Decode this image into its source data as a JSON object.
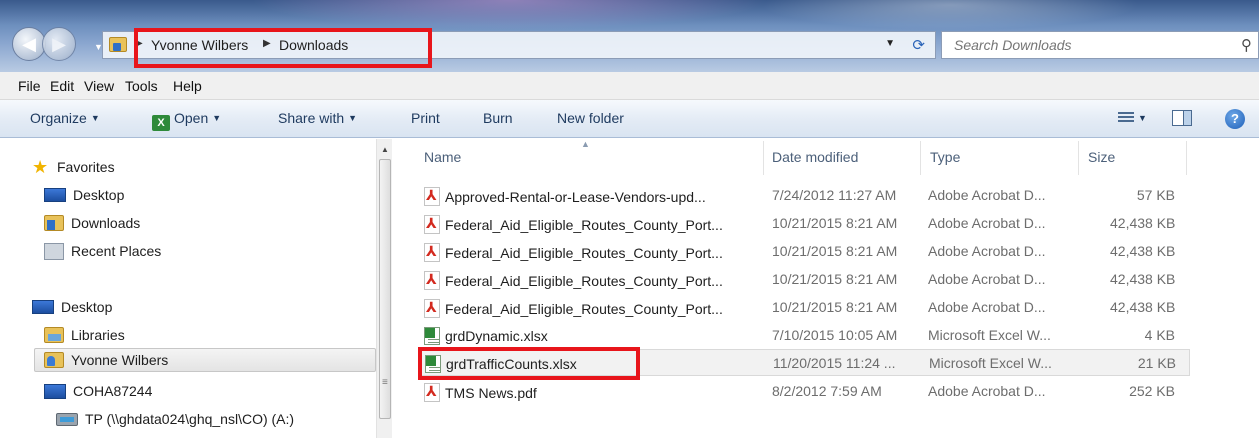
{
  "address": {
    "breadcrumbs": [
      "Yvonne Wilbers",
      "Downloads"
    ],
    "search_placeholder": "Search Downloads"
  },
  "menu": [
    "File",
    "Edit",
    "View",
    "Tools",
    "Help"
  ],
  "toolbar": {
    "organize": "Organize",
    "open": "Open",
    "share_with": "Share with",
    "print": "Print",
    "burn": "Burn",
    "new_folder": "New folder"
  },
  "nav": {
    "favorites": "Favorites",
    "desktop_fav": "Desktop",
    "downloads": "Downloads",
    "recent_places": "Recent Places",
    "desktop_root": "Desktop",
    "libraries": "Libraries",
    "user": "Yvonne Wilbers",
    "computer": "COHA87244",
    "network_drive": "TP (\\\\ghdata024\\ghq_nsl\\CO) (A:)"
  },
  "columns": {
    "name": "Name",
    "date": "Date modified",
    "type": "Type",
    "size": "Size"
  },
  "files": [
    {
      "name": "Approved-Rental-or-Lease-Vendors-upd...",
      "date": "7/24/2012 11:27 AM",
      "type": "Adobe Acrobat D...",
      "size": "57 KB",
      "icon": "pdf-icon"
    },
    {
      "name": "Federal_Aid_Eligible_Routes_County_Port...",
      "date": "10/21/2015 8:21 AM",
      "type": "Adobe Acrobat D...",
      "size": "42,438 KB",
      "icon": "pdf-icon"
    },
    {
      "name": "Federal_Aid_Eligible_Routes_County_Port...",
      "date": "10/21/2015 8:21 AM",
      "type": "Adobe Acrobat D...",
      "size": "42,438 KB",
      "icon": "pdf-icon"
    },
    {
      "name": "Federal_Aid_Eligible_Routes_County_Port...",
      "date": "10/21/2015 8:21 AM",
      "type": "Adobe Acrobat D...",
      "size": "42,438 KB",
      "icon": "pdf-icon"
    },
    {
      "name": "Federal_Aid_Eligible_Routes_County_Port...",
      "date": "10/21/2015 8:21 AM",
      "type": "Adobe Acrobat D...",
      "size": "42,438 KB",
      "icon": "pdf-icon"
    },
    {
      "name": "grdDynamic.xlsx",
      "date": "7/10/2015 10:05 AM",
      "type": "Microsoft Excel W...",
      "size": "4 KB",
      "icon": "excel-icon"
    },
    {
      "name": "grdTrafficCounts.xlsx",
      "date": "11/20/2015 11:24 ...",
      "type": "Microsoft Excel W...",
      "size": "21 KB",
      "icon": "excel-icon"
    },
    {
      "name": "TMS News.pdf",
      "date": "8/2/2012 7:59 AM",
      "type": "Adobe Acrobat D...",
      "size": "252 KB",
      "icon": "pdf-icon"
    }
  ],
  "colors": {
    "highlight_red": "#e8151b",
    "toolbar_text": "#1e3a5f"
  }
}
